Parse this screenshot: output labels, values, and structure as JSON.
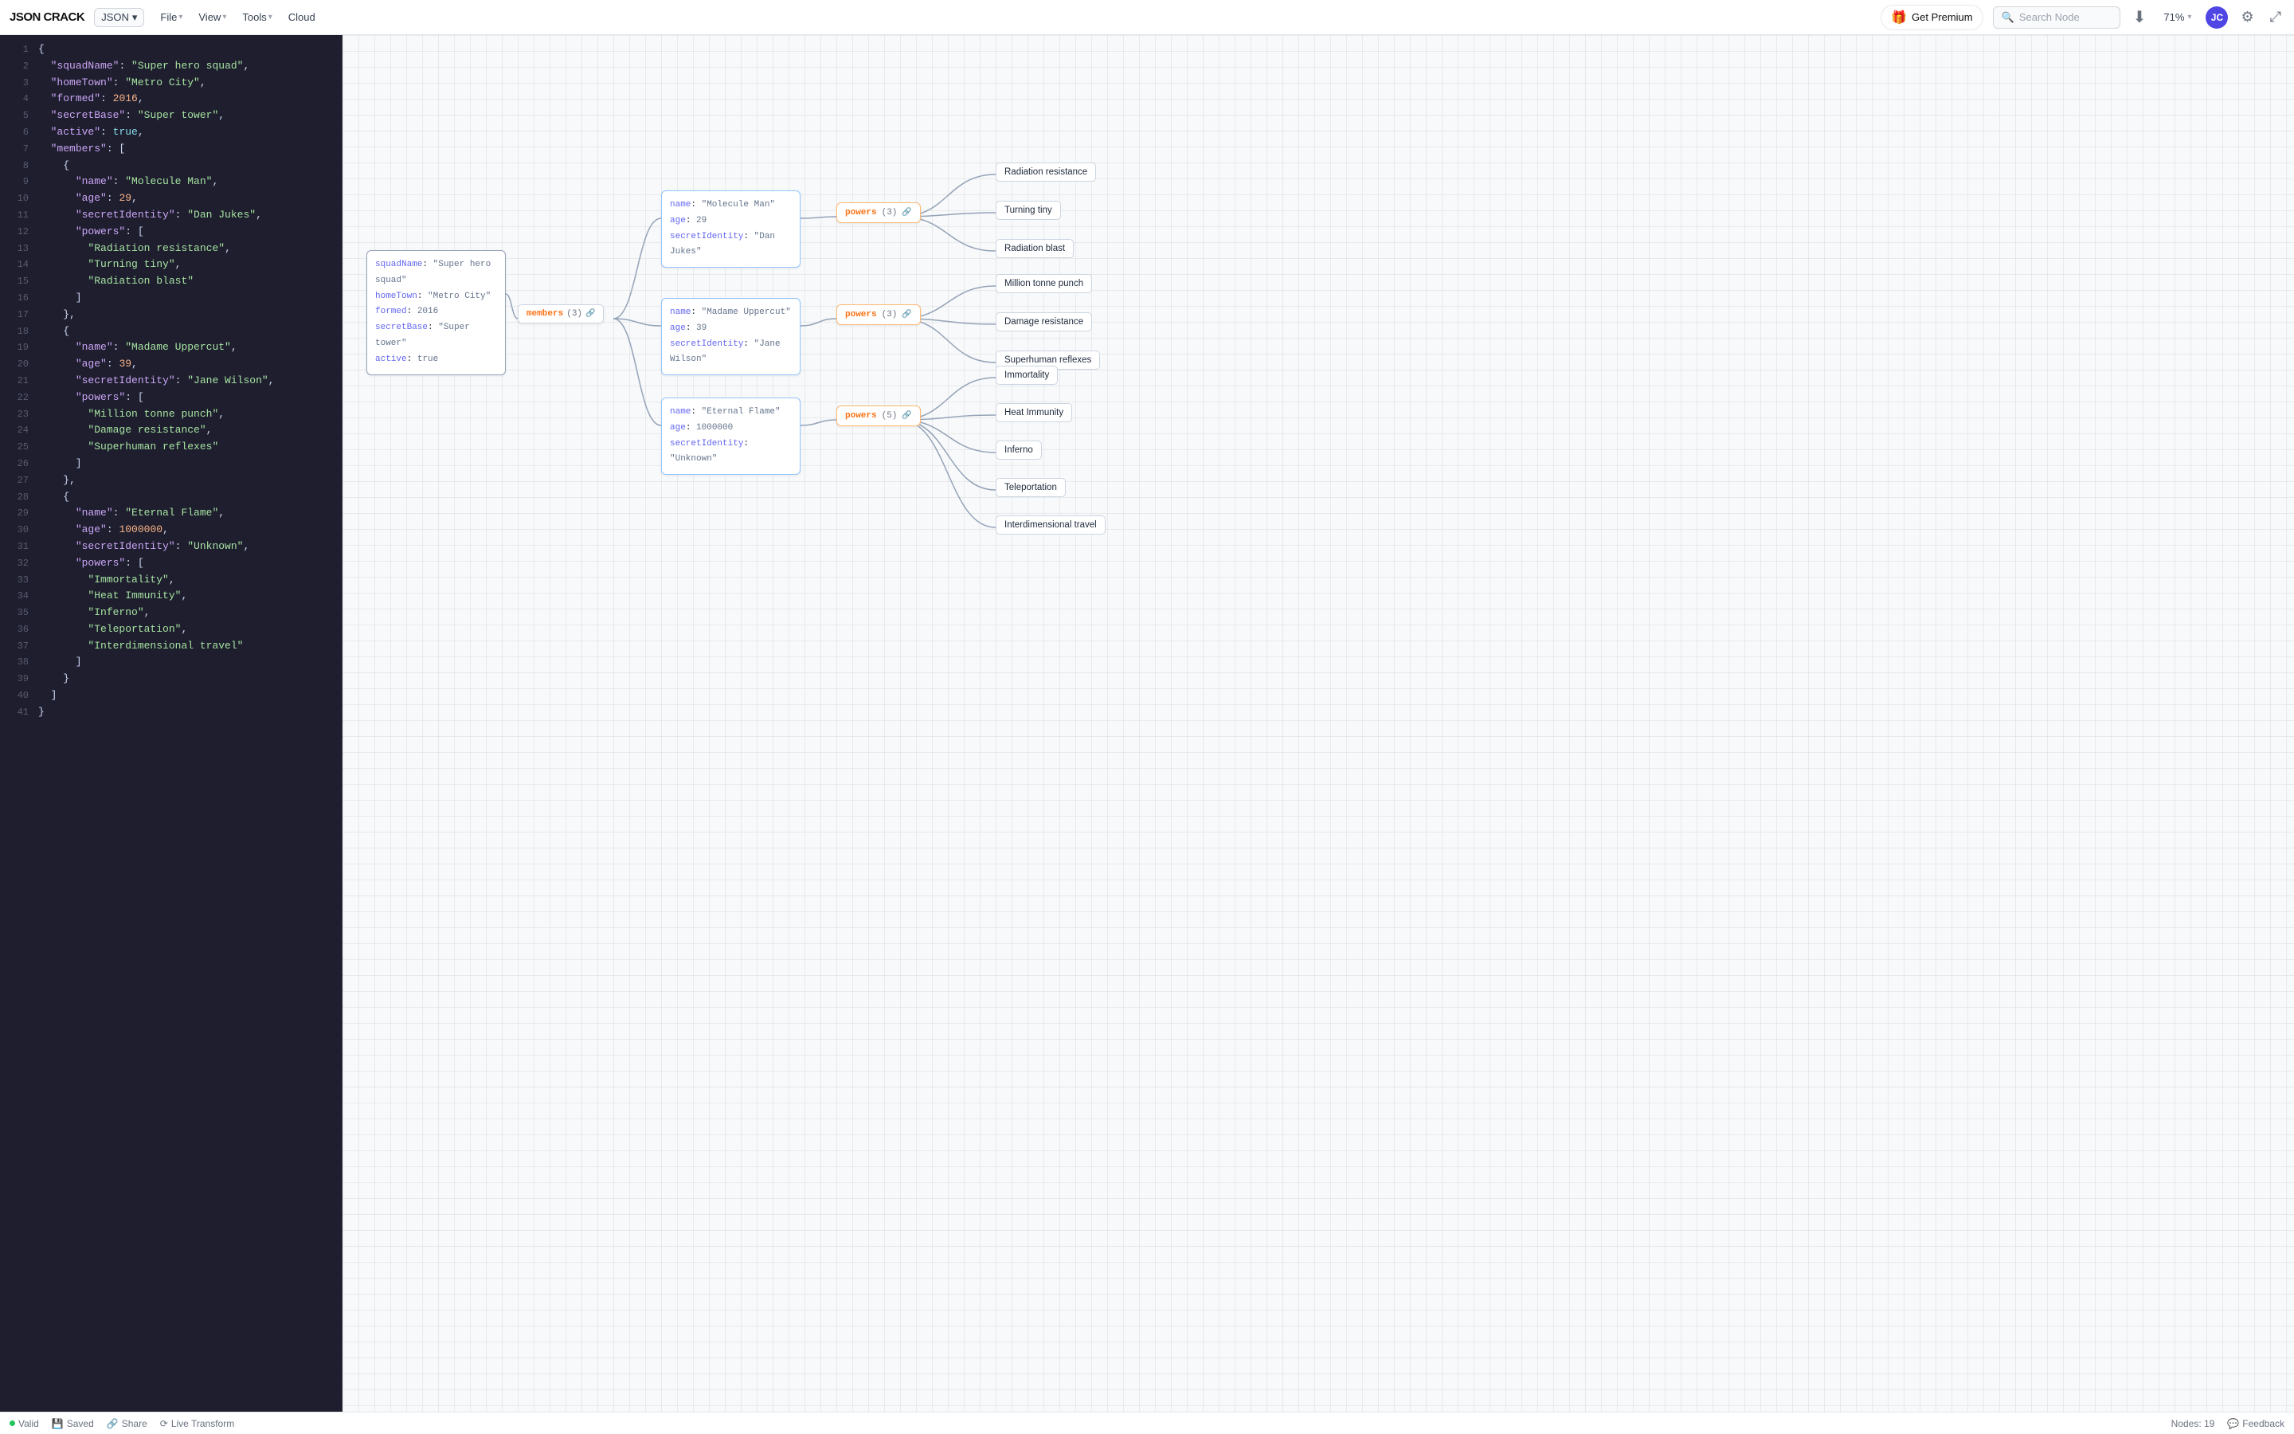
{
  "header": {
    "logo": "JSON CRACK",
    "format_selector": "JSON",
    "menus": [
      {
        "label": "File",
        "has_chevron": true
      },
      {
        "label": "View",
        "has_chevron": true
      },
      {
        "label": "Tools",
        "has_chevron": true
      },
      {
        "label": "Cloud",
        "has_chevron": false
      }
    ],
    "premium_label": "Get Premium",
    "search_placeholder": "Search Node",
    "zoom": "71%",
    "avatar_initials": "JC"
  },
  "editor": {
    "lines": [
      {
        "num": 1,
        "text": "{"
      },
      {
        "num": 2,
        "tokens": [
          {
            "t": "p",
            "v": "  "
          },
          {
            "t": "k",
            "v": "\"squadName\""
          },
          {
            "t": "p",
            "v": ": "
          },
          {
            "t": "s",
            "v": "\"Super hero squad\""
          },
          {
            "t": "p",
            "v": ","
          }
        ]
      },
      {
        "num": 3,
        "tokens": [
          {
            "t": "p",
            "v": "  "
          },
          {
            "t": "k",
            "v": "\"homeTown\""
          },
          {
            "t": "p",
            "v": ": "
          },
          {
            "t": "s",
            "v": "\"Metro City\""
          },
          {
            "t": "p",
            "v": ","
          }
        ]
      },
      {
        "num": 4,
        "tokens": [
          {
            "t": "p",
            "v": "  "
          },
          {
            "t": "k",
            "v": "\"formed\""
          },
          {
            "t": "p",
            "v": ": "
          },
          {
            "t": "n",
            "v": "2016"
          },
          {
            "t": "p",
            "v": ","
          }
        ]
      },
      {
        "num": 5,
        "tokens": [
          {
            "t": "p",
            "v": "  "
          },
          {
            "t": "k",
            "v": "\"secretBase\""
          },
          {
            "t": "p",
            "v": ": "
          },
          {
            "t": "s",
            "v": "\"Super tower\""
          },
          {
            "t": "p",
            "v": ","
          }
        ]
      },
      {
        "num": 6,
        "tokens": [
          {
            "t": "p",
            "v": "  "
          },
          {
            "t": "k",
            "v": "\"active\""
          },
          {
            "t": "p",
            "v": ": "
          },
          {
            "t": "b",
            "v": "true"
          },
          {
            "t": "p",
            "v": ","
          }
        ]
      },
      {
        "num": 7,
        "tokens": [
          {
            "t": "p",
            "v": "  "
          },
          {
            "t": "k",
            "v": "\"members\""
          },
          {
            "t": "p",
            "v": ": ["
          }
        ]
      },
      {
        "num": 8,
        "text": "    {"
      },
      {
        "num": 9,
        "tokens": [
          {
            "t": "p",
            "v": "      "
          },
          {
            "t": "k",
            "v": "\"name\""
          },
          {
            "t": "p",
            "v": ": "
          },
          {
            "t": "s",
            "v": "\"Molecule Man\""
          },
          {
            "t": "p",
            "v": ","
          }
        ]
      },
      {
        "num": 10,
        "tokens": [
          {
            "t": "p",
            "v": "      "
          },
          {
            "t": "k",
            "v": "\"age\""
          },
          {
            "t": "p",
            "v": ": "
          },
          {
            "t": "n",
            "v": "29"
          },
          {
            "t": "p",
            "v": ","
          }
        ]
      },
      {
        "num": 11,
        "tokens": [
          {
            "t": "p",
            "v": "      "
          },
          {
            "t": "k",
            "v": "\"secretIdentity\""
          },
          {
            "t": "p",
            "v": ": "
          },
          {
            "t": "s",
            "v": "\"Dan Jukes\""
          },
          {
            "t": "p",
            "v": ","
          }
        ]
      },
      {
        "num": 12,
        "tokens": [
          {
            "t": "p",
            "v": "      "
          },
          {
            "t": "k",
            "v": "\"powers\""
          },
          {
            "t": "p",
            "v": ": ["
          }
        ]
      },
      {
        "num": 13,
        "tokens": [
          {
            "t": "p",
            "v": "        "
          },
          {
            "t": "s",
            "v": "\"Radiation resistance\""
          },
          {
            "t": "p",
            "v": ","
          }
        ]
      },
      {
        "num": 14,
        "tokens": [
          {
            "t": "p",
            "v": "        "
          },
          {
            "t": "s",
            "v": "\"Turning tiny\""
          },
          {
            "t": "p",
            "v": ","
          }
        ]
      },
      {
        "num": 15,
        "tokens": [
          {
            "t": "p",
            "v": "        "
          },
          {
            "t": "s",
            "v": "\"Radiation blast\""
          }
        ]
      },
      {
        "num": 16,
        "text": "      ]"
      },
      {
        "num": 17,
        "text": "    },"
      },
      {
        "num": 18,
        "text": "    {"
      },
      {
        "num": 19,
        "tokens": [
          {
            "t": "p",
            "v": "      "
          },
          {
            "t": "k",
            "v": "\"name\""
          },
          {
            "t": "p",
            "v": ": "
          },
          {
            "t": "s",
            "v": "\"Madame Uppercut\""
          },
          {
            "t": "p",
            "v": ","
          }
        ]
      },
      {
        "num": 20,
        "tokens": [
          {
            "t": "p",
            "v": "      "
          },
          {
            "t": "k",
            "v": "\"age\""
          },
          {
            "t": "p",
            "v": ": "
          },
          {
            "t": "n",
            "v": "39"
          },
          {
            "t": "p",
            "v": ","
          }
        ]
      },
      {
        "num": 21,
        "tokens": [
          {
            "t": "p",
            "v": "      "
          },
          {
            "t": "k",
            "v": "\"secretIdentity\""
          },
          {
            "t": "p",
            "v": ": "
          },
          {
            "t": "s",
            "v": "\"Jane Wilson\""
          },
          {
            "t": "p",
            "v": ","
          }
        ]
      },
      {
        "num": 22,
        "tokens": [
          {
            "t": "p",
            "v": "      "
          },
          {
            "t": "k",
            "v": "\"powers\""
          },
          {
            "t": "p",
            "v": ": ["
          }
        ]
      },
      {
        "num": 23,
        "tokens": [
          {
            "t": "p",
            "v": "        "
          },
          {
            "t": "s",
            "v": "\"Million tonne punch\""
          },
          {
            "t": "p",
            "v": ","
          }
        ]
      },
      {
        "num": 24,
        "tokens": [
          {
            "t": "p",
            "v": "        "
          },
          {
            "t": "s",
            "v": "\"Damage resistance\""
          },
          {
            "t": "p",
            "v": ","
          }
        ]
      },
      {
        "num": 25,
        "tokens": [
          {
            "t": "p",
            "v": "        "
          },
          {
            "t": "s",
            "v": "\"Superhuman reflexes\""
          }
        ]
      },
      {
        "num": 26,
        "text": "      ]"
      },
      {
        "num": 27,
        "text": "    },"
      },
      {
        "num": 28,
        "text": "    {"
      },
      {
        "num": 29,
        "tokens": [
          {
            "t": "p",
            "v": "      "
          },
          {
            "t": "k",
            "v": "\"name\""
          },
          {
            "t": "p",
            "v": ": "
          },
          {
            "t": "s",
            "v": "\"Eternal Flame\""
          },
          {
            "t": "p",
            "v": ","
          }
        ]
      },
      {
        "num": 30,
        "tokens": [
          {
            "t": "p",
            "v": "      "
          },
          {
            "t": "k",
            "v": "\"age\""
          },
          {
            "t": "p",
            "v": ": "
          },
          {
            "t": "n",
            "v": "1000000"
          },
          {
            "t": "p",
            "v": ","
          }
        ]
      },
      {
        "num": 31,
        "tokens": [
          {
            "t": "p",
            "v": "      "
          },
          {
            "t": "k",
            "v": "\"secretIdentity\""
          },
          {
            "t": "p",
            "v": ": "
          },
          {
            "t": "s",
            "v": "\"Unknown\""
          },
          {
            "t": "p",
            "v": ","
          }
        ]
      },
      {
        "num": 32,
        "tokens": [
          {
            "t": "p",
            "v": "      "
          },
          {
            "t": "k",
            "v": "\"powers\""
          },
          {
            "t": "p",
            "v": ": ["
          }
        ]
      },
      {
        "num": 33,
        "tokens": [
          {
            "t": "p",
            "v": "        "
          },
          {
            "t": "s",
            "v": "\"Immortality\""
          },
          {
            "t": "p",
            "v": ","
          }
        ]
      },
      {
        "num": 34,
        "tokens": [
          {
            "t": "p",
            "v": "        "
          },
          {
            "t": "s",
            "v": "\"Heat Immunity\""
          },
          {
            "t": "p",
            "v": ","
          }
        ]
      },
      {
        "num": 35,
        "tokens": [
          {
            "t": "p",
            "v": "        "
          },
          {
            "t": "s",
            "v": "\"Inferno\""
          },
          {
            "t": "p",
            "v": ","
          }
        ]
      },
      {
        "num": 36,
        "tokens": [
          {
            "t": "p",
            "v": "        "
          },
          {
            "t": "s",
            "v": "\"Teleportation\""
          },
          {
            "t": "p",
            "v": ","
          }
        ]
      },
      {
        "num": 37,
        "tokens": [
          {
            "t": "p",
            "v": "        "
          },
          {
            "t": "s",
            "v": "\"Interdimensional travel\""
          }
        ]
      },
      {
        "num": 38,
        "text": "      ]"
      },
      {
        "num": 39,
        "text": "    }"
      },
      {
        "num": 40,
        "text": "  ]"
      },
      {
        "num": 41,
        "text": "}"
      }
    ]
  },
  "graph": {
    "root_node": {
      "squadName": "\"Super hero squad\"",
      "homeTown": "\"Metro City\"",
      "formed": "2016",
      "secretBase": "\"Super tower\"",
      "active": "true"
    },
    "members_btn": {
      "label": "members",
      "count": "(3)"
    },
    "members": [
      {
        "name": "\"Molecule Man\"",
        "age": "29",
        "secretIdentity": "\"Dan Jukes\"",
        "powers_count": "(3)",
        "powers": [
          "Radiation resistance",
          "Turning tiny",
          "Radiation blast"
        ]
      },
      {
        "name": "\"Madame Uppercut\"",
        "age": "39",
        "secretIdentity": "\"Jane Wilson\"",
        "powers_count": "(3)",
        "powers": [
          "Million tonne punch",
          "Damage resistance",
          "Superhuman reflexes"
        ]
      },
      {
        "name": "\"Eternal Flame\"",
        "age": "1000000",
        "secretIdentity": "\"Unknown\"",
        "powers_count": "(5)",
        "powers": [
          "Immortality",
          "Heat Immunity",
          "Inferno",
          "Teleportation",
          "Interdimensional travel"
        ]
      }
    ]
  },
  "statusbar": {
    "valid_label": "Valid",
    "saved_label": "Saved",
    "share_label": "Share",
    "live_transform_label": "Live Transform",
    "nodes_label": "Nodes: 19",
    "feedback_label": "Feedback"
  }
}
